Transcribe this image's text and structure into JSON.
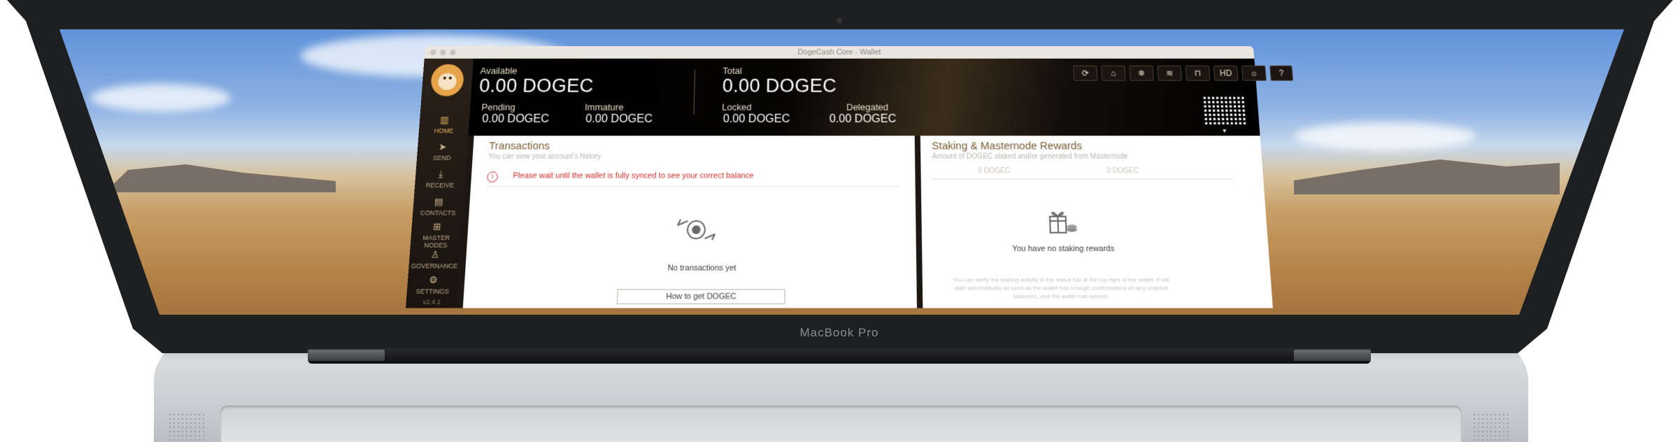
{
  "device": {
    "label": "MacBook Pro"
  },
  "window": {
    "title": "DogeCash Core - Wallet"
  },
  "sidebar": {
    "items": [
      {
        "label": "HOME",
        "icon": "home-icon"
      },
      {
        "label": "SEND",
        "icon": "send-icon"
      },
      {
        "label": "RECEIVE",
        "icon": "receive-icon"
      },
      {
        "label": "CONTACTS",
        "icon": "contacts-icon"
      },
      {
        "label": "MASTER NODES",
        "icon": "masternodes-icon"
      },
      {
        "label": "GOVERNANCE",
        "icon": "governance-icon"
      },
      {
        "label": "SETTINGS",
        "icon": "settings-icon"
      }
    ],
    "version": "v2.4.1"
  },
  "balances": {
    "available_label": "Available",
    "available": "0.00 DOGEC",
    "pending_label": "Pending",
    "pending": "0.00 DOGEC",
    "immature_label": "Immature",
    "immature": "0.00 DOGEC",
    "total_label": "Total",
    "total": "0.00 DOGEC",
    "locked_label": "Locked",
    "locked": "0.00 DOGEC",
    "delegated_label": "Delegated",
    "delegated": "0.00 DOGEC"
  },
  "toolbar": {
    "sync": "⟳",
    "tor": "⌂",
    "staking": "❄",
    "network": "≋",
    "lock": "⊓",
    "hd": "HD",
    "theme": "☼",
    "help": "?"
  },
  "transactions": {
    "title": "Transactions",
    "subtitle": "You can view your account's history",
    "warning": "Please wait until the wallet is fully synced to see your correct balance",
    "empty": "No transactions yet",
    "help_button": "How to get DOGEC"
  },
  "rewards": {
    "title": "Staking & Masternode Rewards",
    "subtitle": "Amount of DOGEC staked and/or generated from Masternode",
    "staked": "0 DOGEC",
    "generated": "0 DOGEC",
    "empty": "You have no staking rewards",
    "note": "You can verify the staking activity in the status bar at the top right of the wallet. It will start automatically as soon as the wallet has enough confirmations on any unspent balances, and the wallet has synced."
  },
  "colors": {
    "accent": "#e6b45c",
    "warning": "#d02a2a",
    "panel_title": "#7a5a33"
  }
}
